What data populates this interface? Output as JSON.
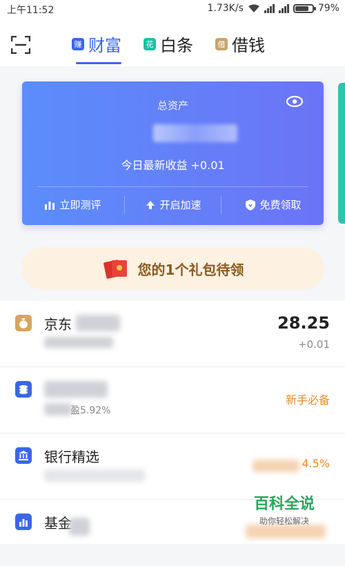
{
  "status_bar": {
    "time": "上午11:52",
    "speed": "1.73K/s",
    "battery": "79%",
    "battery_level": 0.79
  },
  "tabs": [
    {
      "badge": "赚",
      "label": "财富",
      "badge_color": "#3b66e6",
      "active": true
    },
    {
      "badge": "花",
      "label": "白条",
      "badge_color": "#19c2a3",
      "active": false
    },
    {
      "badge": "借",
      "label": "借钱",
      "badge_color": "#c9a46b",
      "active": false
    }
  ],
  "asset_card": {
    "label": "总资产",
    "earnings_text": "今日最新收益 +0.01",
    "actions": [
      {
        "icon": "bar-chart-icon",
        "label": "立即测评"
      },
      {
        "icon": "arrow-up-icon",
        "label": "开启加速"
      },
      {
        "icon": "shield-icon",
        "label": "免费领取"
      }
    ]
  },
  "gift_banner": {
    "text": "您的1个礼包待领"
  },
  "list": [
    {
      "icon": "money-bag-icon",
      "icon_color": "#d9a55b",
      "title": "京东",
      "value": "28.25",
      "value_sub": "+0.01"
    },
    {
      "icon": "coin-stack-icon",
      "icon_color": "#3b66e6",
      "title": "",
      "subtitle": "盈5.92%",
      "tag": "新手必备"
    },
    {
      "icon": "bank-icon",
      "icon_color": "#3b66e6",
      "title": "银行精选",
      "tag": "4.5%"
    },
    {
      "icon": "fund-chart-icon",
      "icon_color": "#3b66e6",
      "title": "基金"
    }
  ],
  "watermark": {
    "title": "百科全说",
    "subtitle": "助你轻松解决"
  }
}
